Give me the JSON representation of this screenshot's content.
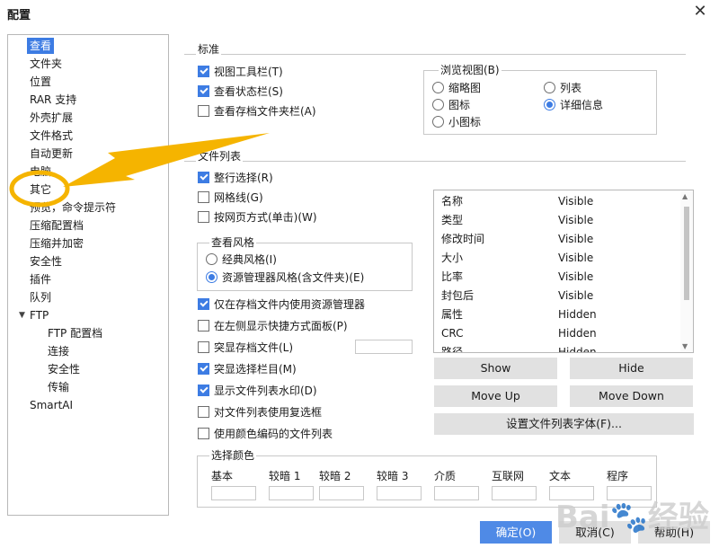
{
  "window": {
    "title": "配置"
  },
  "tree": {
    "items": [
      {
        "label": "查看",
        "sel": true
      },
      {
        "label": "文件夹"
      },
      {
        "label": "位置"
      },
      {
        "label": "RAR 支持"
      },
      {
        "label": "外壳扩展"
      },
      {
        "label": "文件格式"
      },
      {
        "label": "自动更新"
      },
      {
        "label": "电脑"
      },
      {
        "label": "其它"
      },
      {
        "label": "预览，命令提示符"
      },
      {
        "label": "压缩配置档"
      },
      {
        "label": "压缩并加密"
      },
      {
        "label": "安全性"
      },
      {
        "label": "插件"
      },
      {
        "label": "队列"
      },
      {
        "label": "FTP"
      },
      {
        "label": "FTP 配置档"
      },
      {
        "label": "连接"
      },
      {
        "label": "安全性"
      },
      {
        "label": "传输"
      },
      {
        "label": "SmartAI"
      }
    ]
  },
  "standard": {
    "label": "标准",
    "toolbar": "视图工具栏(T)",
    "statusbar": "查看状态栏(S)",
    "archive_folder": "查看存档文件夹栏(A)"
  },
  "browse_view": {
    "label": "浏览视图(B)",
    "thumbnails": "缩略图",
    "list": "列表",
    "icons": "图标",
    "details": "详细信息",
    "small_icons": "小图标"
  },
  "file_list": {
    "label": "文件列表",
    "full_row": "整行选择(R)",
    "grid": "网格线(G)",
    "web_style": "按网页方式(单击)(W)"
  },
  "view_style": {
    "label": "查看风格",
    "classic": "经典风格(I)",
    "explorer": "资源管理器风格(含文件夹)(E)"
  },
  "options": {
    "explorer_in_archive": "仅在存档文件内使用资源管理器",
    "shortcut_panel": "在左侧显示快捷方式面板(P)",
    "highlight_archive": "突显存档文件(L)",
    "highlight_selected": "突显选择栏目(M)",
    "watermark": "显示文件列表水印(D)",
    "checkboxes": "对文件列表使用复选框",
    "color_coded": "使用颜色编码的文件列表"
  },
  "columns": [
    {
      "name": "名称",
      "vis": "Visible"
    },
    {
      "name": "类型",
      "vis": "Visible"
    },
    {
      "name": "修改时间",
      "vis": "Visible"
    },
    {
      "name": "大小",
      "vis": "Visible"
    },
    {
      "name": "比率",
      "vis": "Visible"
    },
    {
      "name": "封包后",
      "vis": "Visible"
    },
    {
      "name": "属性",
      "vis": "Hidden"
    },
    {
      "name": "CRC",
      "vis": "Hidden"
    },
    {
      "name": "路径",
      "vis": "Hidden"
    }
  ],
  "buttons": {
    "show": "Show",
    "hide": "Hide",
    "move_up": "Move Up",
    "move_down": "Move Down",
    "font": "设置文件列表字体(F)...",
    "ok": "确定(O)",
    "cancel": "取消(C)",
    "help": "帮助(H)"
  },
  "colors": {
    "label": "选择颜色",
    "items": [
      "基本",
      "较暗 1",
      "较暗 2",
      "较暗 3",
      "介质",
      "互联网",
      "文本",
      "程序"
    ]
  },
  "accent": "#3d7ce3",
  "annotation_color": "#f5b400"
}
